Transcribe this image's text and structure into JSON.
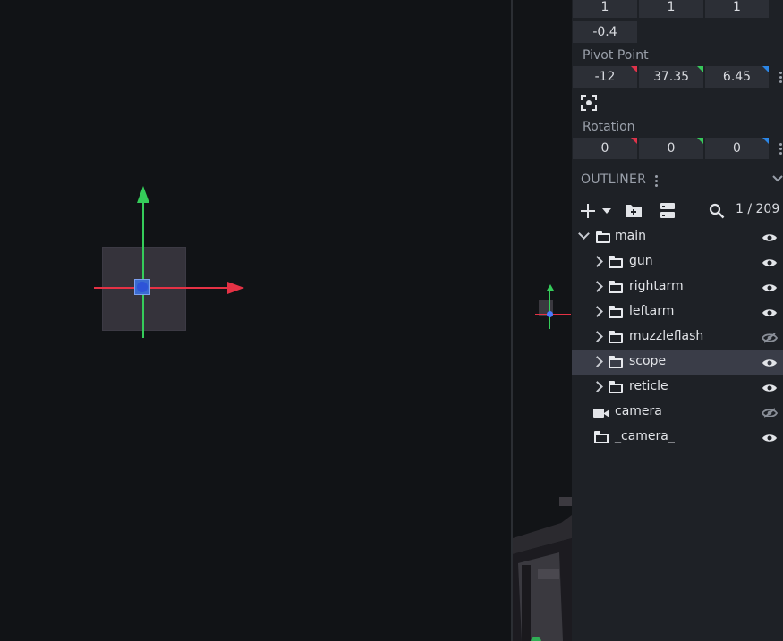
{
  "transform": {
    "scale_row": [
      "1",
      "1",
      "1"
    ],
    "extra_value": "-0.4",
    "pivot_label": "Pivot Point",
    "pivot": [
      "-12",
      "37.35",
      "6.45"
    ],
    "rotation_label": "Rotation",
    "rotation": [
      "0",
      "0",
      "0"
    ]
  },
  "outliner": {
    "title": "OUTLINER",
    "counter": "1 / 209",
    "items": [
      {
        "label": "main",
        "icon": "folder-icon",
        "expanded": true,
        "visible": true
      },
      {
        "label": "gun",
        "icon": "folder-icon",
        "visible": true
      },
      {
        "label": "rightarm",
        "icon": "folder-icon",
        "visible": true
      },
      {
        "label": "leftarm",
        "icon": "folder-icon",
        "visible": true
      },
      {
        "label": "muzzleflash",
        "icon": "folder-icon",
        "visible": false
      },
      {
        "label": "scope",
        "icon": "folder-icon",
        "visible": true,
        "selected": true
      },
      {
        "label": "reticle",
        "icon": "folder-icon",
        "visible": true
      },
      {
        "label": "camera",
        "icon": "camera-icon",
        "visible": false
      },
      {
        "label": "_camera_",
        "icon": "folder-icon",
        "visible": true
      }
    ]
  },
  "colors": {
    "x_axis": "#e53245",
    "y_axis": "#35cc5a",
    "z_axis": "#2b86e6",
    "selection": "#3a3d48"
  }
}
